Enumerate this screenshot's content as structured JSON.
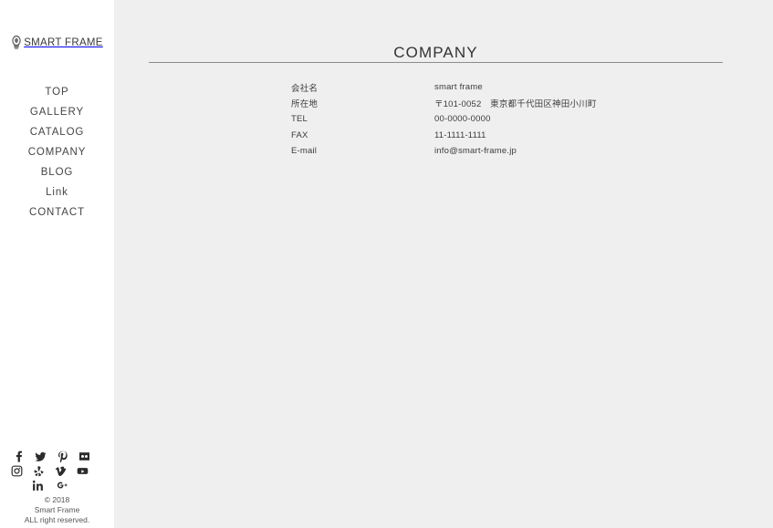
{
  "site": {
    "logo_text": "SMART FRAME",
    "logo_icon": "lamp-icon"
  },
  "sidebar": {
    "nav_items": [
      {
        "label": "TOP",
        "name": "nav-item-top"
      },
      {
        "label": "GALLERY",
        "name": "nav-item-gallery"
      },
      {
        "label": "CATALOG",
        "name": "nav-item-catalog"
      },
      {
        "label": "COMPANY",
        "name": "nav-item-company"
      },
      {
        "label": "BLOG",
        "name": "nav-item-blog"
      },
      {
        "label": "Link",
        "name": "nav-item-link"
      },
      {
        "label": "CONTACT",
        "name": "nav-item-contact"
      }
    ],
    "social_icons": [
      {
        "name": "facebook-icon",
        "row": 1
      },
      {
        "name": "twitter-icon",
        "row": 1
      },
      {
        "name": "pinterest-icon",
        "row": 1
      },
      {
        "name": "flickr-icon",
        "row": 1
      },
      {
        "name": "instagram-icon",
        "row": 2
      },
      {
        "name": "yelp-icon",
        "row": 2
      },
      {
        "name": "vimeo-icon",
        "row": 2
      },
      {
        "name": "youtube-icon",
        "row": 2
      },
      {
        "name": "linkedin-icon",
        "row": 3
      },
      {
        "name": "googleplus-icon",
        "row": 3
      }
    ],
    "copyright": {
      "line1": "© 2018",
      "line2": "Smart Frame",
      "line3": "ALL right reserved."
    }
  },
  "main": {
    "page_title": "COMPANY",
    "info_rows": [
      {
        "label": "会社名",
        "value": "smart frame"
      },
      {
        "label": "所在地",
        "value": "〒101-0052　東京都千代田区神田小川町"
      },
      {
        "label": "TEL",
        "value": "00-0000-0000"
      },
      {
        "label": "FAX",
        "value": "11-1111-1111"
      },
      {
        "label": "E-mail",
        "value": "info@smart-frame.jp"
      }
    ]
  },
  "colors": {
    "page_background": "#efefef",
    "sidebar_background": "#ffffff",
    "text": "#3c3c3c",
    "rule": "#8d8d8d"
  }
}
